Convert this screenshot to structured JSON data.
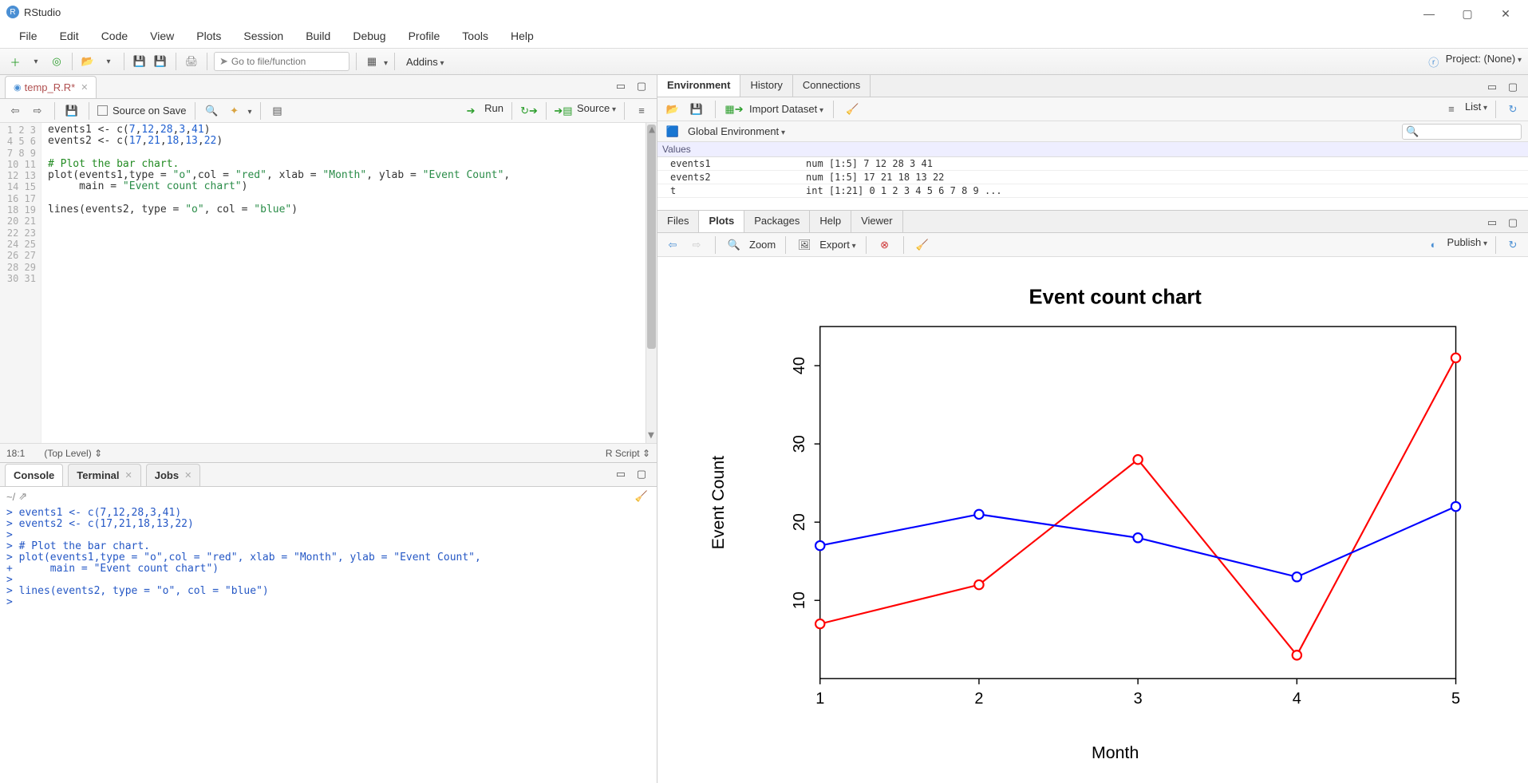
{
  "window": {
    "title": "RStudio"
  },
  "menu": [
    "File",
    "Edit",
    "Code",
    "View",
    "Plots",
    "Session",
    "Build",
    "Debug",
    "Profile",
    "Tools",
    "Help"
  ],
  "toolbar": {
    "gotofile_placeholder": "Go to file/function",
    "addins_label": "Addins",
    "project_label": "Project: (None)"
  },
  "editor": {
    "tab_name": "temp_R.R*",
    "source_on_save": "Source on Save",
    "run_label": "Run",
    "source_label": "Source",
    "status_pos": "18:1",
    "status_scope": "(Top Level)",
    "status_lang": "R Script",
    "line_count": 31,
    "code_lines": [
      {
        "t": "plain",
        "s": "events1 <- c(7,12,28,3,41)"
      },
      {
        "t": "plain",
        "s": "events2 <- c(17,21,18,13,22)"
      },
      {
        "t": "empty",
        "s": ""
      },
      {
        "t": "cmt",
        "s": "# Plot the bar chart."
      },
      {
        "t": "call",
        "s": "plot(events1,type = \"o\",col = \"red\", xlab = \"Month\", ylab = \"Event Count\","
      },
      {
        "t": "cont",
        "s": "     main = \"Event count chart\")"
      },
      {
        "t": "empty",
        "s": ""
      },
      {
        "t": "call",
        "s": "lines(events2, type = \"o\", col = \"blue\")"
      }
    ]
  },
  "console": {
    "tabs": [
      "Console",
      "Terminal",
      "Jobs"
    ],
    "path": "~/",
    "lines": [
      "> events1 <- c(7,12,28,3,41)",
      "> events2 <- c(17,21,18,13,22)",
      "> ",
      "> # Plot the bar chart.",
      "> plot(events1,type = \"o\",col = \"red\", xlab = \"Month\", ylab = \"Event Count\",",
      "+      main = \"Event count chart\")",
      "> ",
      "> lines(events2, type = \"o\", col = \"blue\")"
    ]
  },
  "env": {
    "tabs": [
      "Environment",
      "History",
      "Connections"
    ],
    "import_label": "Import Dataset",
    "list_label": "List",
    "scope": "Global Environment",
    "section": "Values",
    "rows": [
      {
        "name": "events1",
        "val": "num [1:5] 7 12 28 3 41"
      },
      {
        "name": "events2",
        "val": "num [1:5] 17 21 18 13 22"
      },
      {
        "name": "t",
        "val": "int [1:21] 0 1 2 3 4 5 6 7 8 9 ..."
      }
    ]
  },
  "plots": {
    "tabs": [
      "Files",
      "Plots",
      "Packages",
      "Help",
      "Viewer"
    ],
    "zoom_label": "Zoom",
    "export_label": "Export",
    "publish_label": "Publish"
  },
  "chart_data": {
    "type": "line",
    "title": "Event count chart",
    "xlabel": "Month",
    "ylabel": "Event Count",
    "x": [
      1,
      2,
      3,
      4,
      5
    ],
    "series": [
      {
        "name": "events1",
        "color": "red",
        "values": [
          7,
          12,
          28,
          3,
          41
        ]
      },
      {
        "name": "events2",
        "color": "blue",
        "values": [
          17,
          21,
          18,
          13,
          22
        ]
      }
    ],
    "ylim": [
      0,
      45
    ],
    "yticks": [
      10,
      20,
      30,
      40
    ],
    "xlim": [
      1,
      5
    ],
    "xticks": [
      1,
      2,
      3,
      4,
      5
    ]
  }
}
